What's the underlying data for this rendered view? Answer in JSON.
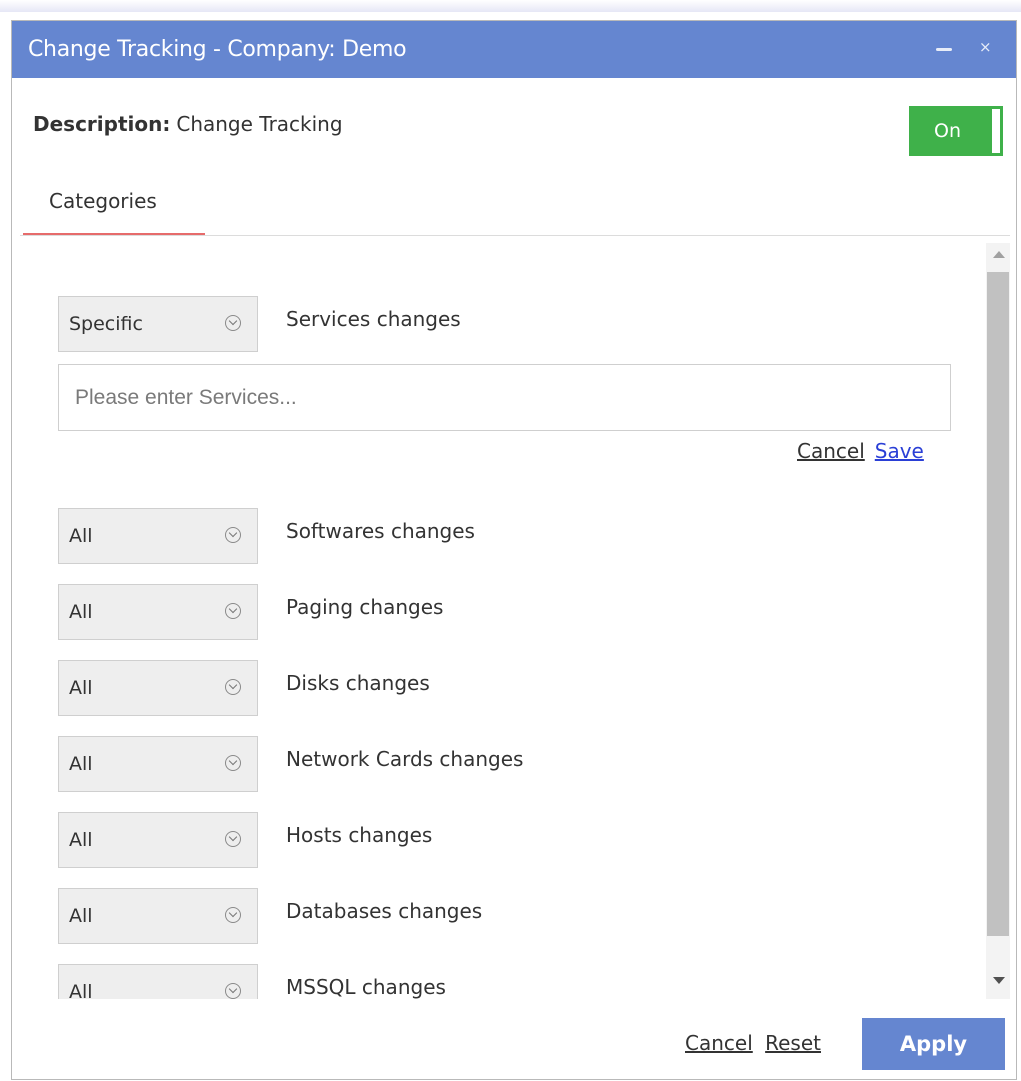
{
  "dialog": {
    "title": "Change Tracking - Company: Demo",
    "minimize_icon": "minimize-icon",
    "close_glyph": "×"
  },
  "description": {
    "label": "Description:",
    "value": "Change Tracking"
  },
  "toggle": {
    "label": "On",
    "state": "on",
    "color": "#3fb14a"
  },
  "tabs": [
    {
      "label": "Categories",
      "active": true
    }
  ],
  "services_input": {
    "placeholder": "Please enter Services...",
    "value": ""
  },
  "inline_actions": {
    "cancel": "Cancel",
    "save": "Save"
  },
  "categories": [
    {
      "scope": "Specific",
      "label": "Services changes"
    },
    {
      "scope": "All",
      "label": "Softwares changes"
    },
    {
      "scope": "All",
      "label": "Paging changes"
    },
    {
      "scope": "All",
      "label": "Disks changes"
    },
    {
      "scope": "All",
      "label": "Network Cards changes"
    },
    {
      "scope": "All",
      "label": "Hosts changes"
    },
    {
      "scope": "All",
      "label": "Databases changes"
    },
    {
      "scope": "All",
      "label": "MSSQL changes"
    }
  ],
  "footer": {
    "cancel": "Cancel",
    "reset": "Reset",
    "apply": "Apply"
  },
  "colors": {
    "titlebar": "#6586d0",
    "tab_underline": "#e66b6b",
    "link_blue": "#2a3fd6"
  }
}
